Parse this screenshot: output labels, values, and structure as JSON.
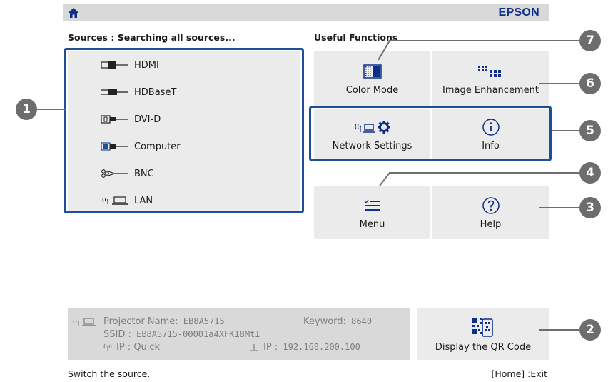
{
  "header": {
    "brand": "EPSON",
    "home_icon": "home-icon"
  },
  "sources": {
    "title": "Sources :",
    "status": "Searching all sources...",
    "items": [
      {
        "label": "HDMI",
        "icon": "hdmi-connector-icon"
      },
      {
        "label": "HDBaseT",
        "icon": "hdbaset-connector-icon"
      },
      {
        "label": "DVI-D",
        "icon": "dvi-connector-icon"
      },
      {
        "label": "Computer",
        "icon": "vga-connector-icon"
      },
      {
        "label": "BNC",
        "icon": "bnc-connector-icon"
      },
      {
        "label": "LAN",
        "icon": "lan-icon"
      }
    ]
  },
  "functions": {
    "title": "Useful Functions",
    "tiles": [
      {
        "label": "Color Mode",
        "icon": "color-mode-icon"
      },
      {
        "label": "Image Enhancement",
        "icon": "image-enhancement-icon"
      },
      {
        "label": "Network Settings",
        "icon": "network-settings-icon"
      },
      {
        "label": "Info",
        "icon": "info-icon"
      },
      {
        "label": "Menu",
        "icon": "menu-icon"
      },
      {
        "label": "Help",
        "icon": "help-icon"
      }
    ]
  },
  "callouts": [
    "1",
    "2",
    "3",
    "4",
    "5",
    "6",
    "7"
  ],
  "network_info": {
    "projector_name_label": "Projector Name:",
    "projector_name": "EB8A5715",
    "keyword_label": "Keyword:",
    "keyword": "8640",
    "ssid_label": "SSID :",
    "ssid": "EB8A5715-00001a4XFK18MtI",
    "wireless_ip_label": "IP : Quick",
    "wired_ip_label": "IP :",
    "wired_ip": "192.168.200.100"
  },
  "qr": {
    "label": "Display the QR Code",
    "icon": "qr-code-icon"
  },
  "footer": {
    "hint": "Switch the source.",
    "exit": "[Home] :Exit"
  },
  "colors": {
    "frame_blue": "#1d4e96",
    "brand_blue": "#0d2f8c",
    "callout_gray": "#6d6d6d",
    "panel_gray": "#ebebeb"
  }
}
